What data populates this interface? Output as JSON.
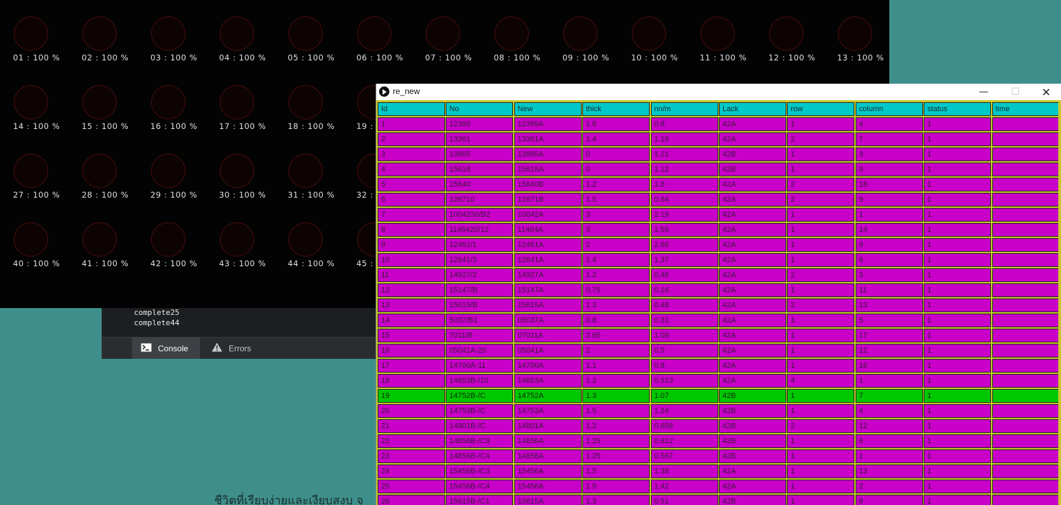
{
  "background": {
    "bottom_text": "ชีวิตที่เรียบง่ายและเงียบสงบ จ"
  },
  "ide": {
    "console_lines": [
      "complete25",
      "complete44"
    ],
    "tabs": [
      {
        "label": "Console",
        "icon": "terminal-icon"
      },
      {
        "label": "Errors",
        "icon": "warning-icon"
      }
    ]
  },
  "sketch": {
    "gauges": [
      "01 : 100 %",
      "02 : 100 %",
      "03 : 100 %",
      "04 : 100 %",
      "05 : 100 %",
      "06 : 100 %",
      "07 : 100 %",
      "08 : 100 %",
      "09 : 100 %",
      "10 : 100 %",
      "11 : 100 %",
      "12 : 100 %",
      "13 : 100 %",
      "14 : 100 %",
      "15 : 100 %",
      "16 : 100 %",
      "17 : 100 %",
      "18 : 100 %",
      "19 :",
      "27 : 100 %",
      "28 : 100 %",
      "29 : 100 %",
      "30 : 100 %",
      "31 : 100 %",
      "32 :",
      "40 : 100 %",
      "41 : 100 %",
      "42 : 100 %",
      "43 : 100 %",
      "44 : 100 %",
      "45 :"
    ]
  },
  "window": {
    "title": "re_new",
    "minimize": "—",
    "maximize": "☐",
    "close": "✕",
    "table": {
      "columns": [
        "Id",
        "No",
        "New",
        "thick",
        "nn/m",
        "Lack",
        "row",
        "column",
        "status",
        "time"
      ],
      "rows": [
        [
          "1",
          "12399",
          "12399A",
          "1.8",
          "0.8",
          "42A",
          "1",
          "4",
          "1",
          ""
        ],
        [
          "2",
          "13361",
          "13361A",
          "1.4",
          "1.19",
          "42A",
          "2",
          "7",
          "1",
          ""
        ],
        [
          "3",
          "13865",
          "13865A",
          "0",
          "1.21",
          "42B",
          "1",
          "3",
          "1",
          ""
        ],
        [
          "4",
          "15618",
          "15618A",
          "0",
          "1.12",
          "42B",
          "1",
          "9",
          "1",
          ""
        ],
        [
          "5",
          "15640",
          "15640B",
          "1.2",
          "1.8",
          "42A",
          "2",
          "18",
          "1",
          ""
        ],
        [
          "6",
          "126710",
          "12671B",
          "1.5",
          "0.84",
          "42A",
          "2",
          "9",
          "1",
          ""
        ],
        [
          "7",
          "1004230/B2",
          "10042A",
          "3",
          "2.19",
          "42A",
          "1",
          "1",
          "1",
          ""
        ],
        [
          "8",
          "1146420/12",
          "11464A",
          "3",
          "1.59",
          "42A",
          "1",
          "14",
          "1",
          ""
        ],
        [
          "9",
          "12461/1",
          "12461A",
          "2",
          "2.66",
          "42A",
          "1",
          "9",
          "1",
          ""
        ],
        [
          "10",
          "12641/3",
          "12641A",
          "1.4",
          "1.37",
          "42A",
          "1",
          "6",
          "1",
          ""
        ],
        [
          "11",
          "14927/2",
          "14927A",
          "1.2",
          "0.46",
          "42A",
          "2",
          "3",
          "1",
          ""
        ],
        [
          "12",
          "15147/B",
          "15147A",
          "0.75",
          "0.16",
          "42A",
          "1",
          "11",
          "1",
          ""
        ],
        [
          "13",
          "15615/B",
          "15615A",
          "1.3",
          "0.48",
          "42A",
          "2",
          "13",
          "1",
          ""
        ],
        [
          "14",
          "5037/B1",
          "05037A",
          "0.8",
          "0.31",
          "42A",
          "1",
          "5",
          "1",
          ""
        ],
        [
          "15",
          "7011/B",
          "07011A",
          "2.65",
          "1.09",
          "42A",
          "1",
          "17",
          "1",
          ""
        ],
        [
          "16",
          "05041A-20",
          "05041A",
          "2",
          "0.5",
          "42A",
          "1",
          "12",
          "1",
          ""
        ],
        [
          "17",
          "14700A-11",
          "14700A",
          "1.1",
          "0.8",
          "42A",
          "1",
          "18",
          "1",
          ""
        ],
        [
          "18",
          "14653B-/10",
          "14653A",
          "1.2",
          "0.513",
          "42A",
          "4",
          "1",
          "1",
          ""
        ],
        [
          "19",
          "14752B-/C",
          "14752A",
          "1.3",
          "1.07",
          "42B",
          "1",
          "7",
          "1",
          ""
        ],
        [
          "20",
          "14753B-/C",
          "14753A",
          "1.5",
          "1.24",
          "42B",
          "1",
          "4",
          "1",
          ""
        ],
        [
          "21",
          "14801B-/C",
          "14801A",
          "1.2",
          "0.656",
          "42B",
          "2",
          "12",
          "1",
          ""
        ],
        [
          "22",
          "14856B-/C3",
          "14856A",
          "1.25",
          "0.612",
          "42B",
          "1",
          "6",
          "1",
          ""
        ],
        [
          "23",
          "14856B-/C4",
          "14856A",
          "1.25",
          "0.567",
          "42B",
          "1",
          "1",
          "1",
          ""
        ],
        [
          "24",
          "15456B-/C3",
          "15456A",
          "1.5",
          "1.38",
          "42A",
          "1",
          "13",
          "1",
          ""
        ],
        [
          "25",
          "15456B-/C4",
          "15456A",
          "1.5",
          "1.42",
          "42A",
          "1",
          "2",
          "1",
          ""
        ],
        [
          "26",
          "15615B-/C1",
          "15615A",
          "1.3",
          "0.51",
          "42B",
          "1",
          "8",
          "1",
          ""
        ]
      ],
      "highlight_row_id": "19"
    }
  },
  "colors": {
    "header_bg": "#00c8c8",
    "row_bg": "#c800c8",
    "highlight_bg": "#00c800",
    "window_border": "#c8c82a",
    "desktop": "#3e8f8c"
  }
}
